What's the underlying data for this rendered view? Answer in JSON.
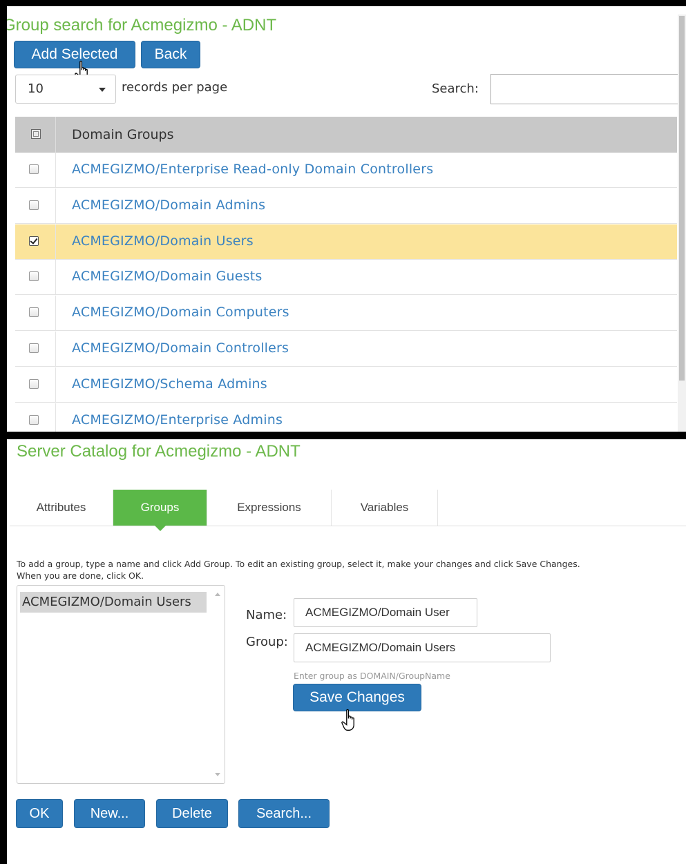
{
  "group_search": {
    "title": "Group search for Acmegizmo - ADNT",
    "add_selected_label": "Add Selected",
    "back_label": "Back",
    "records_per_page_value": "10",
    "records_per_page_label": "records per page",
    "search_label": "Search:",
    "search_value": "",
    "column_header": "Domain Groups",
    "rows": [
      {
        "label": "ACMEGIZMO/Enterprise Read-only Domain Controllers",
        "checked": false
      },
      {
        "label": "ACMEGIZMO/Domain Admins",
        "checked": false
      },
      {
        "label": "ACMEGIZMO/Domain Users",
        "checked": true
      },
      {
        "label": "ACMEGIZMO/Domain Guests",
        "checked": false
      },
      {
        "label": "ACMEGIZMO/Domain Computers",
        "checked": false
      },
      {
        "label": "ACMEGIZMO/Domain Controllers",
        "checked": false
      },
      {
        "label": "ACMEGIZMO/Schema Admins",
        "checked": false
      },
      {
        "label": "ACMEGIZMO/Enterprise Admins",
        "checked": false
      }
    ]
  },
  "server_catalog": {
    "title": "Server Catalog for Acmegizmo - ADNT",
    "tabs": [
      {
        "label": "Attributes",
        "active": false
      },
      {
        "label": "Groups",
        "active": true
      },
      {
        "label": "Expressions",
        "active": false
      },
      {
        "label": "Variables",
        "active": false
      }
    ],
    "instructions_line1": "To add a group, type a name and click Add Group. To edit an existing group, select it, make your changes and click Save Changes.",
    "instructions_line2": "When you are done, click OK.",
    "group_list": [
      "ACMEGIZMO/Domain Users"
    ],
    "name_label": "Name:",
    "name_value": "ACMEGIZMO/Domain User",
    "group_label": "Group:",
    "group_value": "ACMEGIZMO/Domain Users",
    "group_hint": "Enter group as DOMAIN/GroupName",
    "save_changes_label": "Save Changes",
    "ok_label": "OK",
    "new_label": "New...",
    "delete_label": "Delete",
    "search_button_label": "Search..."
  },
  "icons": {
    "cursor": "hand-pointer-icon",
    "header_checkbox": "select-all-checkbox-icon",
    "dropdown": "caret-down-icon"
  },
  "colors": {
    "title_green": "#6cb84a",
    "button_blue": "#2d79b8",
    "link_blue": "#3a82c1",
    "selected_row": "#fbe49b",
    "active_tab": "#5bb848"
  }
}
